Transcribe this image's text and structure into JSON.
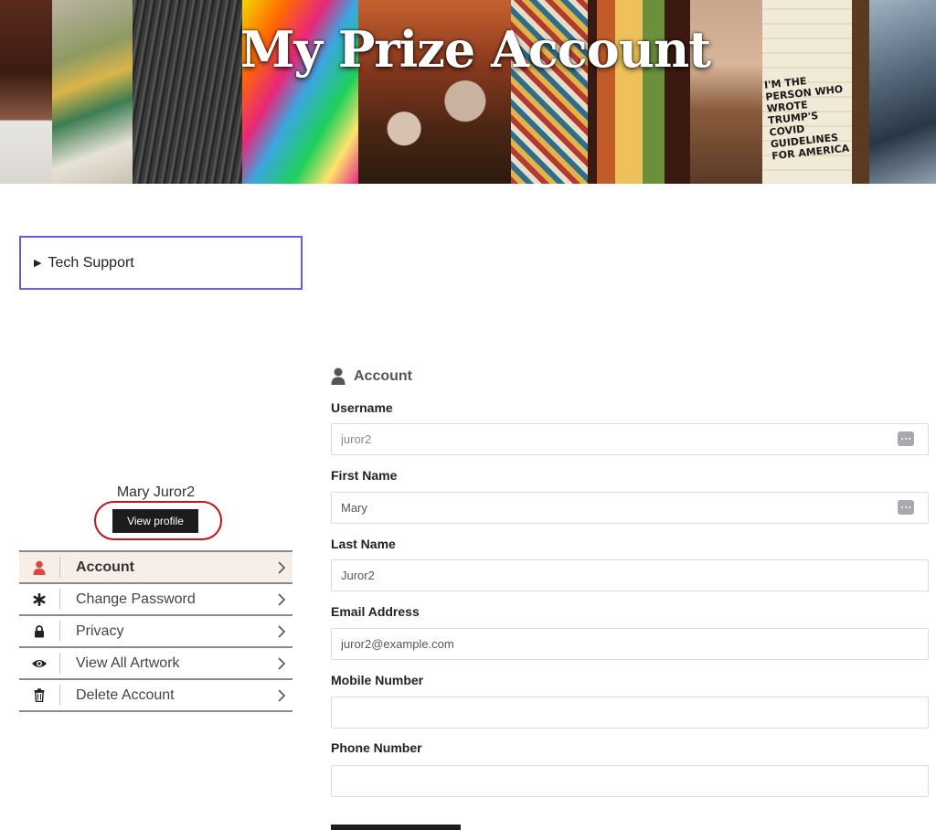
{
  "banner": {
    "title": "My Prize Account",
    "sign_text": "I'M THE PERSON WHO WROTE TRUMP'S COVID GUIDELINES FOR AMERICA"
  },
  "tech_support": {
    "label": "Tech Support"
  },
  "profile": {
    "name": "Mary Juror2",
    "view_button": "View profile"
  },
  "menu": {
    "items": [
      {
        "label": "Account",
        "icon": "user-icon",
        "active": true
      },
      {
        "label": "Change Password",
        "icon": "asterisk-icon",
        "active": false
      },
      {
        "label": "Privacy",
        "icon": "lock-icon",
        "active": false
      },
      {
        "label": "View All Artwork",
        "icon": "eye-icon",
        "active": false
      },
      {
        "label": "Delete Account",
        "icon": "trash-icon",
        "active": false
      }
    ]
  },
  "form": {
    "section_title": "Account",
    "username": {
      "label": "Username",
      "value": "juror2"
    },
    "first_name": {
      "label": "First Name",
      "value": "Mary"
    },
    "last_name": {
      "label": "Last Name",
      "value": "Juror2"
    },
    "email": {
      "label": "Email Address",
      "value": "juror2@example.com"
    },
    "mobile": {
      "label": "Mobile Number",
      "value": ""
    },
    "phone": {
      "label": "Phone Number",
      "value": ""
    }
  },
  "colors": {
    "accent_red": "#d9493f",
    "highlight_ring": "#c0151b",
    "tech_border": "#6a5ae0",
    "active_row": "#f8eee8"
  }
}
